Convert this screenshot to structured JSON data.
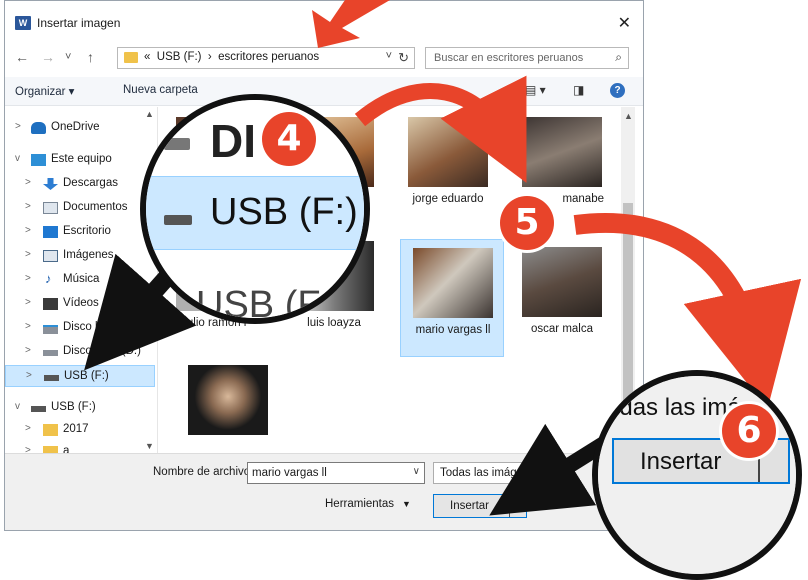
{
  "window": {
    "title": "Insertar imagen",
    "app_icon": "word-icon",
    "close": "✕"
  },
  "nav": {
    "back": "←",
    "forward": "→",
    "recent": "˅",
    "up": "↑",
    "address": {
      "overflow": "«",
      "crumbs": [
        "USB (F:)",
        "escritores peruanos"
      ],
      "separator": "›",
      "dropdown": "˅",
      "refresh": "↻"
    },
    "search": {
      "placeholder": "Buscar en escritores peruanos",
      "icon": "search-icon"
    }
  },
  "toolbar": {
    "organize": "Organizar ▾",
    "new_folder": "Nueva carpeta",
    "view_icon": "view-icon",
    "pane_icon": "preview-pane-icon",
    "help": "?"
  },
  "sidebar": {
    "items": [
      {
        "label": "OneDrive",
        "icon": "onedrive-icon",
        "expand": ">",
        "indent": 0
      },
      {
        "label": "Este equipo",
        "icon": "computer-icon",
        "expand": "v",
        "indent": 0
      },
      {
        "label": "Descargas",
        "icon": "downloads-icon",
        "expand": ">",
        "indent": 1
      },
      {
        "label": "Documentos",
        "icon": "documents-icon",
        "expand": ">",
        "indent": 1
      },
      {
        "label": "Escritorio",
        "icon": "desktop-icon",
        "expand": ">",
        "indent": 1
      },
      {
        "label": "Imágenes",
        "icon": "pictures-icon",
        "expand": ">",
        "indent": 1
      },
      {
        "label": "Música",
        "icon": "music-icon",
        "expand": ">",
        "indent": 1
      },
      {
        "label": "Vídeos",
        "icon": "videos-icon",
        "expand": ">",
        "indent": 1
      },
      {
        "label": "Disco local (C",
        "icon": "drive-c-icon",
        "expand": ">",
        "indent": 1
      },
      {
        "label": "Disco local (D:)",
        "icon": "drive-icon",
        "expand": ">",
        "indent": 1
      },
      {
        "label": "USB (F:)",
        "icon": "usb-drive-icon",
        "expand": ">",
        "indent": 1,
        "selected": true
      },
      {
        "label": "USB (F:)",
        "icon": "usb-drive-icon",
        "expand": "v",
        "indent": 0
      },
      {
        "label": "2017",
        "icon": "folder-icon",
        "expand": ">",
        "indent": 1
      },
      {
        "label": "a",
        "icon": "folder-icon",
        "expand": ">",
        "indent": 1
      }
    ]
  },
  "files": [
    {
      "name": "",
      "color": "#5b3a2a"
    },
    {
      "name": "",
      "color": "#a86a3a"
    },
    {
      "name": "jorge eduardo",
      "color": "#8a5a3a"
    },
    {
      "name": "manabe",
      "color": "#5f5650"
    },
    {
      "name": "julio ramon r",
      "color": "#b0b0b0"
    },
    {
      "name": "luis loayza",
      "color": "#7c7c7c"
    },
    {
      "name": "mario vargas ll",
      "color": "#6e5f52",
      "selected": true
    },
    {
      "name": "oscar malca",
      "color": "#6a5e55"
    },
    {
      "name": "",
      "color": "#303030"
    }
  ],
  "bottom": {
    "filename_label": "Nombre de archivo:",
    "filename_value": "mario vargas ll",
    "filter": "Todas las imágenes",
    "tools": "Herramientas",
    "insert": "Insertar"
  },
  "callouts": {
    "magnifier_left": {
      "drive_partial": "DI",
      "drive": "USB (F:)",
      "drive_below": "USB (F:)"
    },
    "magnifier_right": {
      "filter_partial": "odas las imá",
      "insert": "Insertar"
    },
    "badges": [
      "4",
      "5",
      "6"
    ],
    "accent": "#e8442a"
  }
}
